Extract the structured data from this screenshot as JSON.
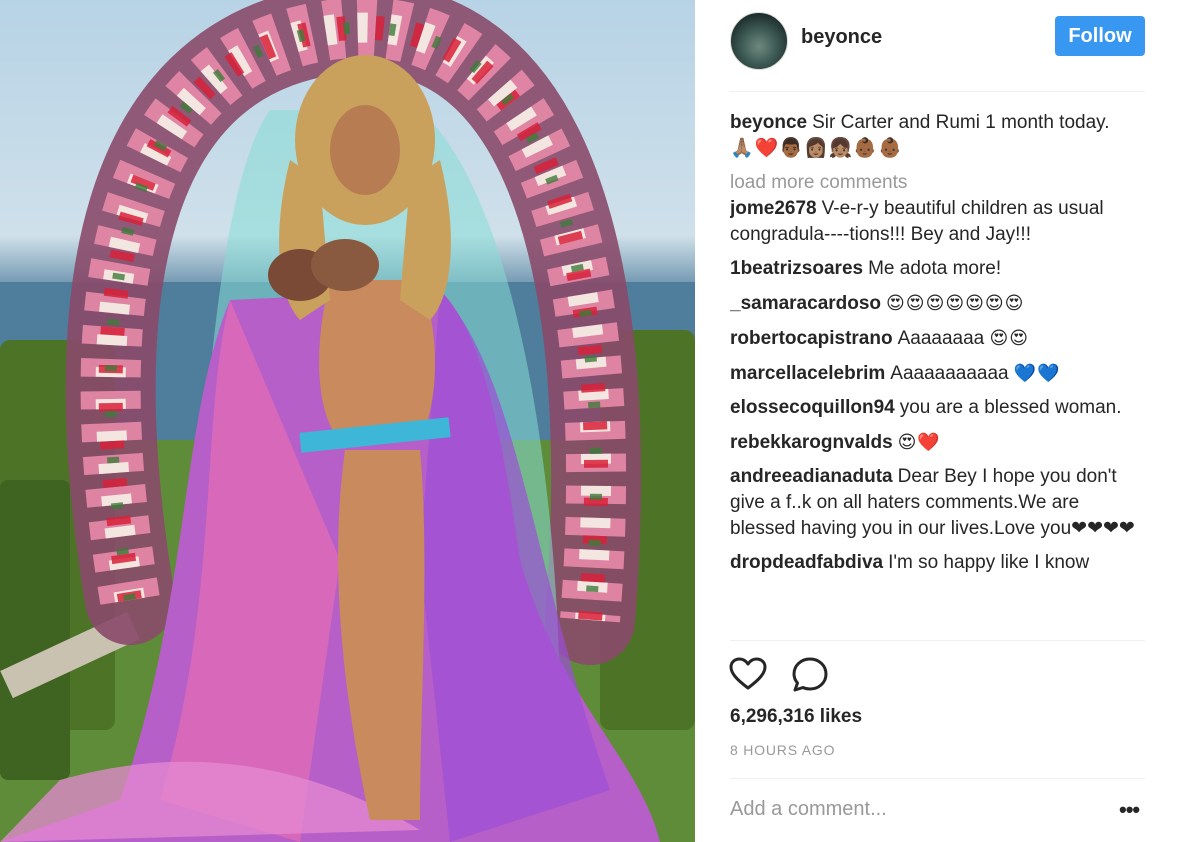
{
  "post": {
    "image_alt": "",
    "author": "beyonce",
    "follow_label": "Follow"
  },
  "caption": {
    "user": "beyonce",
    "text": "Sir Carter and Rumi 1 month today.",
    "emoji": "🙏🏽❤️👨🏾👩🏽👧🏽👶🏾👶🏾"
  },
  "load_more": "load more comments",
  "comments": [
    {
      "user": "jome2678",
      "text": "V-e-r-y beautiful children as usual congradula----tions!!! Bey and Jay!!!",
      "emoji": ""
    },
    {
      "user": "1beatrizsoares",
      "text": "Me adota more!",
      "emoji": ""
    },
    {
      "user": "_samaracardoso",
      "text": "",
      "emoji": "😍😍😍😍😍😍😍"
    },
    {
      "user": "robertocapistrano",
      "text": "Aaaaaaaa",
      "emoji": "😍😍"
    },
    {
      "user": "marcellacelebrim",
      "text": "Aaaaaaaaaaa",
      "emoji": "💙💙"
    },
    {
      "user": "elossecoquillon94",
      "text": "you are a blessed woman.",
      "emoji": ""
    },
    {
      "user": "rebekkarognvalds",
      "text": "",
      "emoji": "😍❤️"
    },
    {
      "user": "andreeadianaduta",
      "text": "Dear Bey I hope you don't give a f..k on all haters comments.We are blessed having you in our lives.Love you❤❤❤❤",
      "emoji": ""
    },
    {
      "user": "dropdeadfabdiva",
      "text": "I'm so happy like I know",
      "emoji": ""
    }
  ],
  "actions": {
    "like_icon": "heart-icon",
    "comment_icon": "speech-bubble-icon"
  },
  "likes": "6,296,316 likes",
  "timestamp": "8 HOURS AGO",
  "add_comment": {
    "placeholder": "Add a comment..."
  },
  "more_options": "•••"
}
